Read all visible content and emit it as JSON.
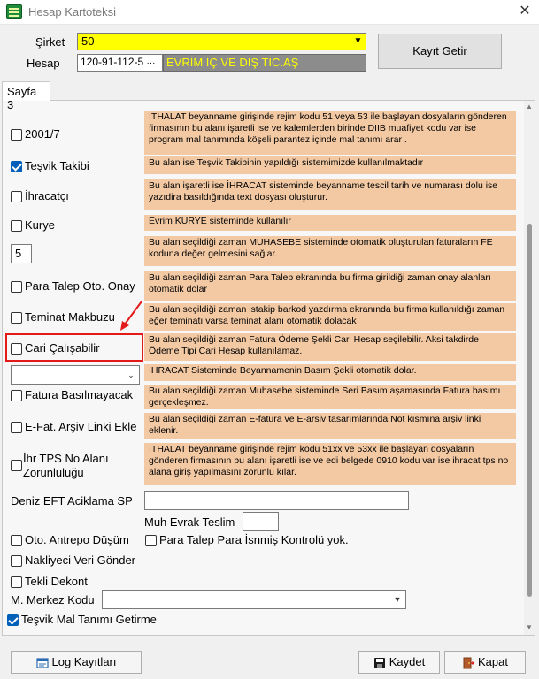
{
  "window": {
    "title": "Hesap Kartoteksi"
  },
  "header": {
    "sirket_label": "Şirket",
    "sirket_value": "50",
    "hesap_label": "Hesap",
    "hesap_code": "120-91-112-5",
    "hesap_ellipsis": "···",
    "hesap_name": "EVRİM İÇ VE DIŞ TİC.AŞ",
    "kayit_getir": "Kayıt Getir"
  },
  "tabs": [
    {
      "label": "Sayfa 3",
      "active": true
    }
  ],
  "rows": [
    {
      "label": "2001/7",
      "checked": false,
      "desc": "İTHALAT beyanname girişinde rejim kodu 51 veya 53 ile başlayan dosyaların gönderen firmasının bu alanı işaretli ise ve kalemlerden birinde DIIB muafiyet kodu var ise program mal tanımında köşeli parantez içinde mal tanımı arar ."
    },
    {
      "label": "Teşvik Takibi",
      "checked": true,
      "desc": "Bu alan ise Teşvik Takibinin yapıldığı sistemimizde kullanılmaktadır"
    },
    {
      "label": "İhracatçı",
      "checked": false,
      "desc": "Bu alan işaretli ise İHRACAT sisteminde beyanname tescil tarih ve numarası dolu ise yazıdira basıldığında text dosyası oluşturur."
    },
    {
      "label": "Kurye",
      "checked": false,
      "desc": "Evrim KURYE sisteminde kullanılır"
    },
    {
      "value": "5",
      "desc": "Bu alan seçildiği zaman MUHASEBE sisteminde otomatik oluşturulan faturaların FE koduna değer gelmesini sağlar."
    },
    {
      "label": "Para Talep Oto. Onay",
      "checked": false,
      "desc": "Bu alan seçildiği zaman Para Talep ekranında bu firma girildiği zaman onay alanları otomatik dolar"
    },
    {
      "label": "Teminat Makbuzu",
      "checked": false,
      "desc": "Bu alan seçildiği zaman istakip barkod yazdırma ekranında bu firma kullanıldığı zaman eğer teminatı varsa teminat alanı otomatik dolacak"
    },
    {
      "label": "Cari Çalışabilir",
      "checked": false,
      "desc": "Bu alan seçildiği zaman Fatura Ödeme Şekli Cari Hesap seçilebilir. Aksi takdirde Ödeme Tipi Cari Hesap kullanılamaz."
    },
    {
      "combo": "",
      "desc": "İHRACAT Sisteminde  Beyannamenin Basım Şekli otomatik dolar."
    },
    {
      "label": "Fatura Basılmayacak",
      "checked": false,
      "desc": "Bu alan seçildiği zaman Muhasebe sisteminde Seri Basım aşamasında Fatura basımı gerçekleşmez."
    },
    {
      "label": "E-Fat. Arşiv Linki Ekle",
      "checked": false,
      "desc": "Bu alan seçildiği zaman E-fatura ve E-arsiv tasarımlarında Not kısmına arşiv linki eklenir."
    },
    {
      "label": "İhr TPS No Alanı Zorunluluğu",
      "label_line1": "İhr TPS No Alanı",
      "label_line2": "Zorunluluğu",
      "checked": false,
      "desc": "İTHALAT beyanname girişinde rejim kodu 51xx ve 53xx ile başlayan dosyaların gönderen firmasının bu alanı işaretli ise ve edi belgede 0910 kodu var ise ihracat tps no alana giriş yapılmasını zorunlu kılar."
    }
  ],
  "fields": {
    "deniz_eft_label": "Deniz EFT Aciklama SP",
    "deniz_eft_value": "",
    "muh_evrak_label": "Muh Evrak Teslim",
    "muh_evrak_value": "",
    "m_merkez_label": "M. Merkez Kodu",
    "m_merkez_value": ""
  },
  "checks": {
    "oto_antrepo": {
      "label": "Oto. Antrepo Düşüm",
      "checked": false
    },
    "para_talep_isnmis": {
      "label": "Para Talep Para İsnmiş Kontrolü yok.",
      "checked": false
    },
    "nakliyeci": {
      "label": "Nakliyeci Veri Gönder",
      "checked": false
    },
    "tekli_dekont": {
      "label": "Tekli Dekont",
      "checked": false
    },
    "tesvik_mal": {
      "label": "Teşvik Mal Tanımı Getirme",
      "checked": true
    }
  },
  "buttons": {
    "log": "Log Kayıtları",
    "kaydet": "Kaydet",
    "kapat": "Kapat"
  },
  "colors": {
    "highlight": "#e21a1a",
    "description_bg": "#f3c9a4",
    "sirket_bg": "#ffff00",
    "hesap_name_bg": "#8c8c8c",
    "hesap_name_fg": "#ffff00"
  }
}
